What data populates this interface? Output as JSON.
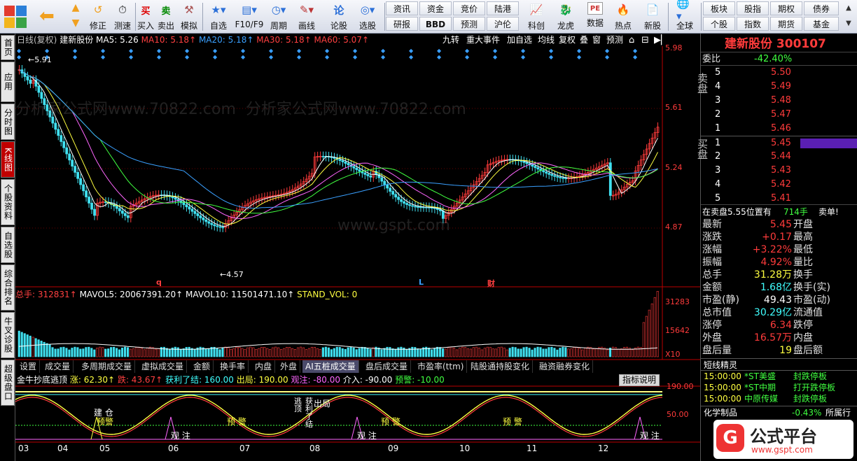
{
  "toolbar": {
    "buttons": [
      {
        "label": "修正",
        "icon": "undo-arrow-icon"
      },
      {
        "label": "测速",
        "icon": "clock-icon"
      },
      {
        "label": "买入",
        "icon": "buy-icon"
      },
      {
        "label": "卖出",
        "icon": "sell-icon"
      },
      {
        "label": "模拟",
        "icon": "gavel-icon"
      },
      {
        "label": "自选",
        "icon": "star-icon"
      },
      {
        "label": "F10/F9",
        "icon": "f10-icon"
      },
      {
        "label": "周期",
        "icon": "period-icon"
      },
      {
        "label": "画线",
        "icon": "pencil-icon"
      },
      {
        "label": "论股",
        "icon": "forum-icon"
      },
      {
        "label": "选股",
        "icon": "stock-picker-icon"
      },
      {
        "label": "科创",
        "icon": "kechuang-icon"
      },
      {
        "label": "龙虎",
        "icon": "dragon-tiger-icon"
      },
      {
        "label": "数据",
        "icon": "pe-data-icon"
      },
      {
        "label": "热点",
        "icon": "hot-icon"
      },
      {
        "label": "新股",
        "icon": "new-stock-icon"
      },
      {
        "label": "全球",
        "icon": "globe-icon"
      }
    ],
    "grid1": [
      "资讯",
      "资金",
      "竞价",
      "陆港",
      "研报",
      "BBD",
      "预测",
      "沪伦"
    ],
    "grid2": [
      "板块",
      "股指",
      "期权",
      "债券",
      "个股",
      "指数",
      "期货",
      "基金"
    ]
  },
  "left_tabs": [
    "首页",
    "应用",
    "分时图",
    "K线图",
    "个股资料",
    "自选股",
    "综合排名",
    "牛叉诊股",
    "超级盘口"
  ],
  "chart": {
    "header": {
      "period": "日线(复权)",
      "stock": "建新股份",
      "ma5": "MA5: 5.26",
      "ma10": "MA10: 5.18↑",
      "ma20": "MA20: 5.18↑",
      "ma30": "MA30: 5.18↑",
      "ma60": "MA60: 5.07↑"
    },
    "right_buttons": [
      "九转",
      "重大事件",
      "加自选",
      "均线",
      "复权",
      "叠",
      "窗",
      "预测"
    ],
    "price_axis": [
      "5.98",
      "5.61",
      "5.24",
      "4.87"
    ],
    "hi_label": "5.91",
    "lo_label": "4.57",
    "markers": [
      "q",
      "L",
      "财"
    ],
    "vol_header": {
      "total": "总手: 312831↑",
      "mavol5": "MAVOL5: 20067391.20↑",
      "mavol10": "MAVOL10: 11501471.10↑",
      "stand": "STAND_VOL: 0"
    },
    "vol_axis": [
      "31283",
      "15642",
      "X10"
    ],
    "sub_tabs": [
      "设置",
      "成交量",
      "多周期成交量",
      "虚拟成交量",
      "金额",
      "换手率",
      "内盘",
      "外盘",
      "AI五桩成交量",
      "盘后成交量",
      "市盈率(ttm)",
      "陆股通持股变化",
      "融资融券变化"
    ],
    "ind_header": {
      "name": "金牛抄底逃顶",
      "up": "涨: 62.30↑",
      "down": "跌: 43.67↑",
      "profit": "获利了结: 160.00",
      "exit": "出局: 190.00",
      "watch": "观注: -80.00",
      "enter": "介入: -90.00",
      "warn": "预警: -10.00"
    },
    "ind_button": "指标说明",
    "ind_axis": [
      "190.00",
      "50.00"
    ],
    "ind_labels": [
      "建",
      "仓",
      "预",
      "警",
      "预",
      "警",
      "预",
      "警",
      "预",
      "警",
      "观",
      "注",
      "观",
      "注",
      "观",
      "注",
      "逃",
      "顶",
      "获",
      "利",
      "了",
      "结",
      "出",
      "局"
    ],
    "months": [
      "03",
      "04",
      "05",
      "06",
      "07",
      "08",
      "09",
      "10",
      "11",
      "12"
    ],
    "watermark": "分析家公式网www.70822.com",
    "watermark2": "www.gspt.com"
  },
  "right_panel": {
    "title": "建新股份 300107",
    "weibi_label": "委比",
    "weibi_value": "-42.40%",
    "sell_mark": "卖盘",
    "buy_mark": "买盘",
    "sell": [
      {
        "lvl": "5",
        "price": "5.50"
      },
      {
        "lvl": "4",
        "price": "5.49"
      },
      {
        "lvl": "3",
        "price": "5.48"
      },
      {
        "lvl": "2",
        "price": "5.47"
      },
      {
        "lvl": "1",
        "price": "5.46"
      }
    ],
    "buy": [
      {
        "lvl": "1",
        "price": "5.45"
      },
      {
        "lvl": "2",
        "price": "5.44"
      },
      {
        "lvl": "3",
        "price": "5.43"
      },
      {
        "lvl": "4",
        "price": "5.42"
      },
      {
        "lvl": "5",
        "price": "5.41"
      }
    ],
    "trade_note": "在卖盘5.55位置有",
    "trade_qty": "714手",
    "trade_side": "卖单!",
    "stats": [
      {
        "k": "最新",
        "v": "5.45",
        "c": "#ff3b3b",
        "k2": "开盘"
      },
      {
        "k": "涨跌",
        "v": "+0.17",
        "c": "#ff3b3b",
        "k2": "最高"
      },
      {
        "k": "涨幅",
        "v": "+3.22%",
        "c": "#ff3b3b",
        "k2": "最低"
      },
      {
        "k": "振幅",
        "v": "4.92%",
        "c": "#ff3b3b",
        "k2": "量比"
      },
      {
        "k": "总手",
        "v": "31.28万",
        "c": "#ffff40",
        "k2": "换手"
      },
      {
        "k": "金额",
        "v": "1.68亿",
        "c": "#40ffff",
        "k2": "换手(实)"
      },
      {
        "k": "市盈(静)",
        "v": "49.43",
        "c": "#ffffff",
        "k2": "市盈(动)"
      },
      {
        "k": "总市值",
        "v": "30.29亿",
        "c": "#40ffff",
        "k2": "流通值"
      },
      {
        "k": "涨停",
        "v": "6.34",
        "c": "#ff3b3b",
        "k2": "跌停"
      },
      {
        "k": "外盘",
        "v": "16.57万",
        "c": "#ff3b3b",
        "k2": "内盘"
      },
      {
        "k": "盘后量",
        "v": "19",
        "c": "#ffff40",
        "k2": "盘后额"
      }
    ],
    "short_title": "短线精灵",
    "news": [
      {
        "time": "15:00:00",
        "name": "*ST美盛",
        "evt": "封跌停板"
      },
      {
        "time": "15:00:00",
        "name": "*ST中期",
        "evt": "打开跌停板"
      },
      {
        "time": "15:00:00",
        "name": "中原传媒",
        "evt": "封跌停板"
      }
    ],
    "sector": "化学制品",
    "sector_pct": "-0.43%",
    "sector_label": "所属行业",
    "brand": "公式平台",
    "brand_url": "www.gspt.com"
  }
}
